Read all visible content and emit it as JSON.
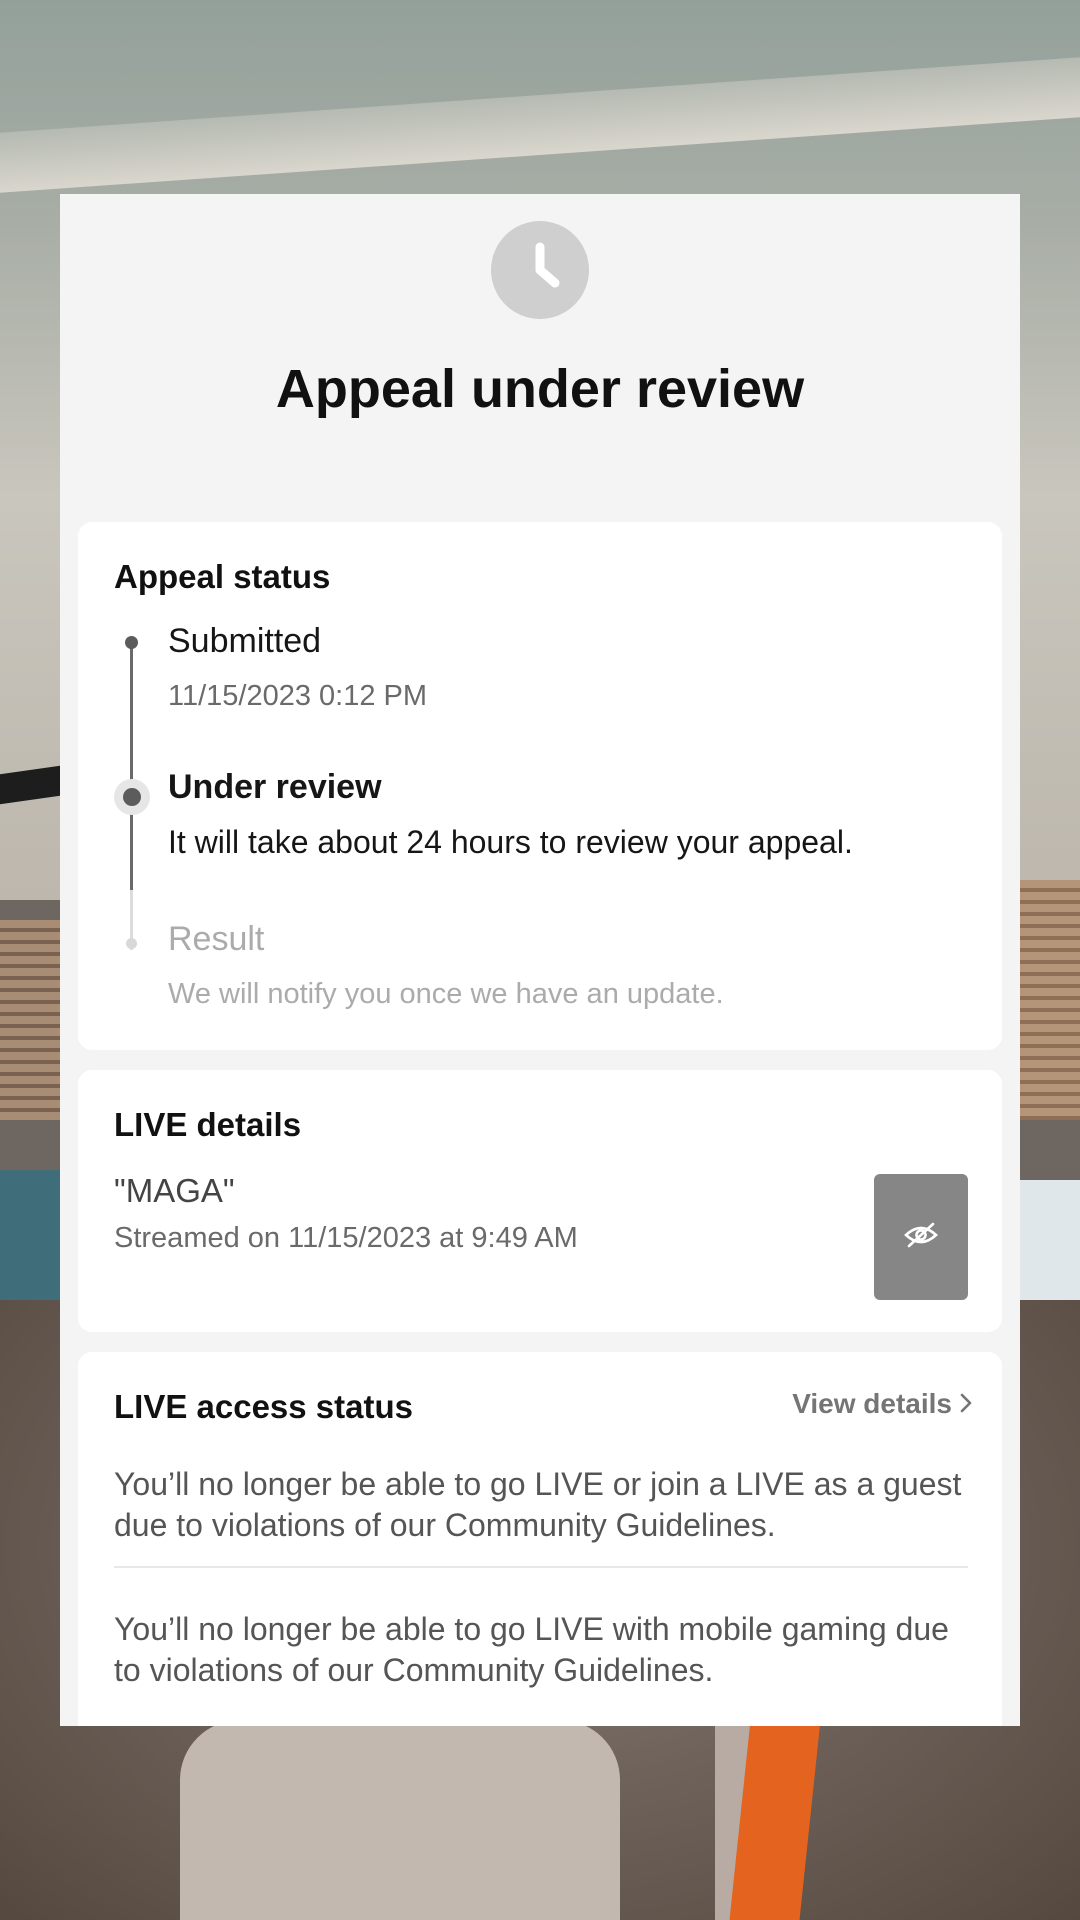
{
  "header": {
    "status_icon": "clock-icon",
    "title": "Appeal under review"
  },
  "appeal_status": {
    "title": "Appeal status",
    "steps": [
      {
        "label": "Submitted",
        "detail": "11/15/2023 0:12 PM",
        "state": "done"
      },
      {
        "label": "Under review",
        "detail": "It will take about 24 hours to review your appeal.",
        "state": "current"
      },
      {
        "label": "Result",
        "detail": "We will notify you once we have an update.",
        "state": "pending"
      }
    ]
  },
  "live_details": {
    "title": "LIVE details",
    "stream_name": "\"MAGA\"",
    "streamed_on": "Streamed on 11/15/2023 at 9:49 AM",
    "thumbnail_icon": "eye-off-icon"
  },
  "live_access": {
    "title": "LIVE access status",
    "view_details_label": "View details",
    "messages": [
      "You’ll no longer be able to go LIVE or join a LIVE as a guest due to violations of our Community Guidelines.",
      "You’ll no longer be able to go LIVE with mobile gaming due to violations of our Community Guidelines."
    ]
  },
  "colors": {
    "panel_bg": "#f4f4f4",
    "card_bg": "#ffffff",
    "timeline_active": "#5c5c5c",
    "timeline_pending": "#d8d8d8",
    "thumbnail_bg": "#868686"
  }
}
